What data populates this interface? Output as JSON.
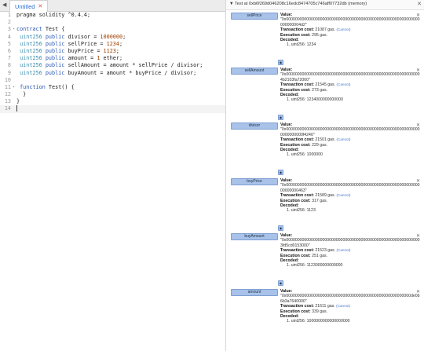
{
  "editor": {
    "tab_label": "Untitled",
    "tab_close": "✕",
    "lines": [
      {
        "num": "1",
        "tokens": [
          [
            "",
            "pragma solidity ^0.4.4;"
          ]
        ]
      },
      {
        "num": "2",
        "tokens": []
      },
      {
        "num": "3",
        "fold": true,
        "tokens": [
          [
            "k",
            "contract"
          ],
          [
            "",
            " Test {"
          ]
        ]
      },
      {
        "num": "4",
        "tokens": [
          [
            "",
            " "
          ],
          [
            "t",
            "uint256"
          ],
          [
            "",
            " "
          ],
          [
            "k",
            "public"
          ],
          [
            "",
            " divisor = "
          ],
          [
            "n",
            "1000000"
          ],
          [
            "",
            ";"
          ]
        ]
      },
      {
        "num": "5",
        "tokens": [
          [
            "",
            " "
          ],
          [
            "t",
            "uint256"
          ],
          [
            "",
            " "
          ],
          [
            "k",
            "public"
          ],
          [
            "",
            " sellPrice = "
          ],
          [
            "n",
            "1234"
          ],
          [
            "",
            ";"
          ]
        ]
      },
      {
        "num": "6",
        "tokens": [
          [
            "",
            " "
          ],
          [
            "t",
            "uint256"
          ],
          [
            "",
            " "
          ],
          [
            "k",
            "public"
          ],
          [
            "",
            " buyPrice = "
          ],
          [
            "n",
            "1123"
          ],
          [
            "",
            ";"
          ]
        ]
      },
      {
        "num": "7",
        "tokens": [
          [
            "",
            " "
          ],
          [
            "t",
            "uint256"
          ],
          [
            "",
            " "
          ],
          [
            "k",
            "public"
          ],
          [
            "",
            " amount = "
          ],
          [
            "n",
            "1"
          ],
          [
            "",
            " ether;"
          ]
        ]
      },
      {
        "num": "8",
        "tokens": [
          [
            "",
            " "
          ],
          [
            "t",
            "uint256"
          ],
          [
            "",
            " "
          ],
          [
            "k",
            "public"
          ],
          [
            "",
            " sellAmount = amount * sellPrice / divisor;"
          ]
        ]
      },
      {
        "num": "9",
        "tokens": [
          [
            "",
            " "
          ],
          [
            "t",
            "uint256"
          ],
          [
            "",
            " "
          ],
          [
            "k",
            "public"
          ],
          [
            "",
            " buyAmount = amount * buyPrice / divisor;"
          ]
        ]
      },
      {
        "num": "10",
        "tokens": []
      },
      {
        "num": "11",
        "fold": true,
        "tokens": [
          [
            "",
            " "
          ],
          [
            "k",
            "function"
          ],
          [
            "",
            " Test() {"
          ]
        ]
      },
      {
        "num": "12",
        "tokens": [
          [
            "",
            "  }"
          ]
        ]
      },
      {
        "num": "13",
        "tokens": [
          [
            "",
            "}"
          ]
        ]
      },
      {
        "num": "14",
        "active": true,
        "tokens": []
      }
    ]
  },
  "panel": {
    "title": "Test at 0xb6f269d046208c16edc8474705c746aff07732db (memory)",
    "close": "✕",
    "entries": [
      {
        "name": "sellPrice",
        "value_label": "Value:",
        "value": "\"0x00000000000000000000000000000000000000000000000000000000000000000004d2\"",
        "cost_label": "Transaction cost:",
        "cost": "21087 gas.",
        "exec_label": "Execution cost:",
        "exec": "295 gas.",
        "decoded_label": "Decoded:",
        "decoded": "1. uint256: 1234",
        "link": "(Cannot)"
      },
      {
        "name": "sellAmount",
        "value_label": "Value:",
        "value": "\"0x000000000000000000000000000000000000000000000000000000000004b2103fa72000\"",
        "cost_label": "Transaction cost:",
        "cost": "21545 gas.",
        "exec_label": "Execution cost:",
        "exec": "273 gas.",
        "decoded_label": "Decoded:",
        "decoded": "1. uint256: 1234000000000000",
        "link": "(Cannot)"
      },
      {
        "name": "divisor",
        "value_label": "Value:",
        "value": "\"0x000000000000000000000000000000000000000000000000000000000000000000000f4240\"",
        "cost_label": "Transaction cost:",
        "cost": "21501 gas.",
        "exec_label": "Execution cost:",
        "exec": "229 gas.",
        "decoded_label": "Decoded:",
        "decoded": "1. uint256: 1000000",
        "link": "(Cannot)"
      },
      {
        "name": "buyPrice",
        "value_label": "Value:",
        "value": "\"0x0000000000000000000000000000000000000000000000000000000000000000000463\"",
        "cost_label": "Transaction cost:",
        "cost": "21589 gas.",
        "exec_label": "Execution cost:",
        "exec": "317 gas.",
        "decoded_label": "Decoded:",
        "decoded": "1. uint256: 1123",
        "link": "(Cannot)"
      },
      {
        "name": "buyAmount",
        "value_label": "Value:",
        "value": "\"0x000000000000000000000000000000000000000000000000000000000003fd5cd0153000\"",
        "cost_label": "Transaction cost:",
        "cost": "21523 gas.",
        "exec_label": "Execution cost:",
        "exec": "251 gas.",
        "decoded_label": "Decoded:",
        "decoded": "1. uint256: 1123000000000000",
        "link": "(Cannot)"
      },
      {
        "name": "amount",
        "value_label": "Value:",
        "value": "\"0x0000000000000000000000000000000000000000000000000000000de0b6b3a7640000\"",
        "cost_label": "Transaction cost:",
        "cost": "21611 gas.",
        "exec_label": "Execution cost:",
        "exec": "339 gas.",
        "decoded_label": "Decoded:",
        "decoded": "1. uint256: 1000000000000000000",
        "link": "(Cannot)"
      }
    ]
  }
}
